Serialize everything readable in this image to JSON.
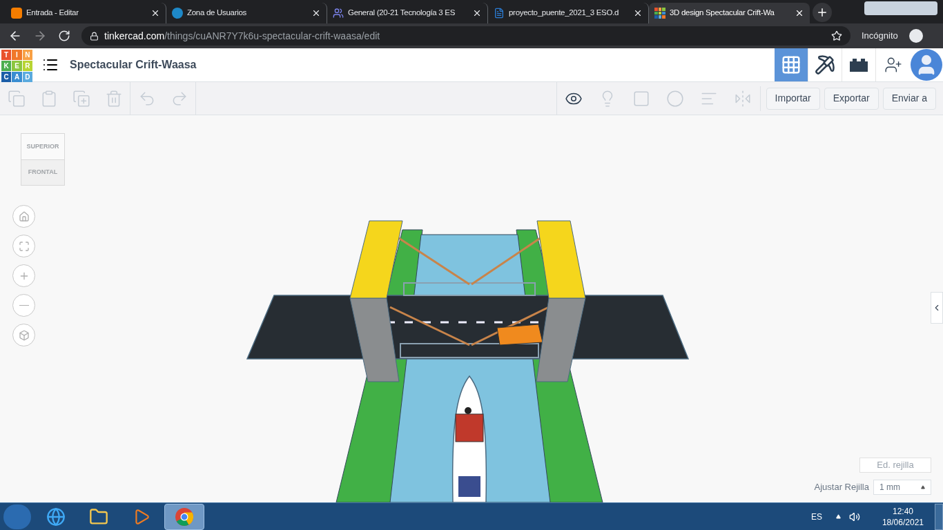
{
  "browser": {
    "tabs": [
      {
        "kind": "blogger",
        "title": "Entrada - Editar",
        "selected": false
      },
      {
        "kind": "zona",
        "title": "Zona de Usuarios",
        "selected": false
      },
      {
        "kind": "teams",
        "title": "General (20-21 Tecnología 3 ES",
        "selected": false
      },
      {
        "kind": "word",
        "title": "proyecto_puente_2021_3 ESO.d",
        "selected": false
      },
      {
        "kind": "tinkercad",
        "title": "3D design Spectacular Crift-Wa",
        "selected": true
      }
    ],
    "address": {
      "host": "tinkercad.com",
      "path": "/things/cuANR7Y7k6u-spectacular-crift-waasa/edit"
    },
    "profile": "Incógnito"
  },
  "header": {
    "logo_tiles": [
      {
        "letter": "T",
        "color": "#e9532d"
      },
      {
        "letter": "I",
        "color": "#f0782a"
      },
      {
        "letter": "N",
        "color": "#f8a044"
      },
      {
        "letter": "K",
        "color": "#4cae4f"
      },
      {
        "letter": "E",
        "color": "#8cc63f"
      },
      {
        "letter": "R",
        "color": "#b8d432"
      },
      {
        "letter": "C",
        "color": "#1c5ea8"
      },
      {
        "letter": "A",
        "color": "#3a8dd1"
      },
      {
        "letter": "D",
        "color": "#5aaade"
      }
    ],
    "design_title": "Spectacular Crift-Waasa",
    "views": [
      {
        "kind": "grid",
        "selected": true
      },
      {
        "kind": "pickaxe",
        "selected": false
      },
      {
        "kind": "brick",
        "selected": false
      }
    ]
  },
  "toolbar": {
    "tools": [
      {
        "kind": "copy",
        "disabled": true
      },
      {
        "kind": "paste",
        "disabled": true
      },
      {
        "kind": "duplicate",
        "disabled": true
      },
      {
        "kind": "delete",
        "disabled": true
      },
      {
        "kind": "undo",
        "disabled": true
      },
      {
        "kind": "redo",
        "disabled": true
      }
    ],
    "view_tools": [
      {
        "kind": "notes",
        "disabled": false
      },
      {
        "kind": "light",
        "disabled": true
      },
      {
        "kind": "solid",
        "disabled": true
      },
      {
        "kind": "hole",
        "disabled": true
      },
      {
        "kind": "align",
        "disabled": true
      },
      {
        "kind": "mirror",
        "disabled": true
      }
    ],
    "buttons": [
      "Importar",
      "Exportar",
      "Enviar a"
    ]
  },
  "view_cube": {
    "top": "SUPERIOR",
    "front": "FRONTAL"
  },
  "grid": {
    "edit_button": "Ed. rejilla",
    "snap_label": "Ajustar Rejilla",
    "snap_value": "1 mm"
  },
  "taskbar": {
    "apps": [
      {
        "kind": "ie",
        "active": false
      },
      {
        "kind": "explorer",
        "active": false
      },
      {
        "kind": "media",
        "active": false
      },
      {
        "kind": "chrome",
        "active": true
      }
    ],
    "language": "ES",
    "time": "12:40",
    "date": "18/06/2021"
  }
}
